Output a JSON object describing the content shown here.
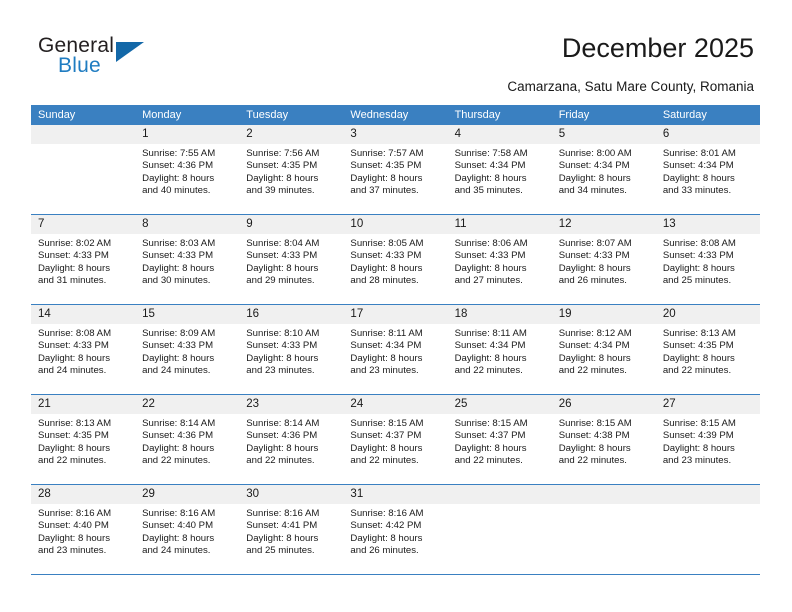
{
  "brand": {
    "name_part1": "General",
    "name_part2": "Blue",
    "accent_color": "#1368a8"
  },
  "header": {
    "title": "December 2025",
    "location": "Camarzana, Satu Mare County, Romania"
  },
  "calendar": {
    "header_bg": "#3a80c1",
    "weekdays": [
      "Sunday",
      "Monday",
      "Tuesday",
      "Wednesday",
      "Thursday",
      "Friday",
      "Saturday"
    ],
    "weeks": [
      [
        {
          "day": "",
          "lines": []
        },
        {
          "day": "1",
          "lines": [
            "Sunrise: 7:55 AM",
            "Sunset: 4:36 PM",
            "Daylight: 8 hours",
            "and 40 minutes."
          ]
        },
        {
          "day": "2",
          "lines": [
            "Sunrise: 7:56 AM",
            "Sunset: 4:35 PM",
            "Daylight: 8 hours",
            "and 39 minutes."
          ]
        },
        {
          "day": "3",
          "lines": [
            "Sunrise: 7:57 AM",
            "Sunset: 4:35 PM",
            "Daylight: 8 hours",
            "and 37 minutes."
          ]
        },
        {
          "day": "4",
          "lines": [
            "Sunrise: 7:58 AM",
            "Sunset: 4:34 PM",
            "Daylight: 8 hours",
            "and 35 minutes."
          ]
        },
        {
          "day": "5",
          "lines": [
            "Sunrise: 8:00 AM",
            "Sunset: 4:34 PM",
            "Daylight: 8 hours",
            "and 34 minutes."
          ]
        },
        {
          "day": "6",
          "lines": [
            "Sunrise: 8:01 AM",
            "Sunset: 4:34 PM",
            "Daylight: 8 hours",
            "and 33 minutes."
          ]
        }
      ],
      [
        {
          "day": "7",
          "lines": [
            "Sunrise: 8:02 AM",
            "Sunset: 4:33 PM",
            "Daylight: 8 hours",
            "and 31 minutes."
          ]
        },
        {
          "day": "8",
          "lines": [
            "Sunrise: 8:03 AM",
            "Sunset: 4:33 PM",
            "Daylight: 8 hours",
            "and 30 minutes."
          ]
        },
        {
          "day": "9",
          "lines": [
            "Sunrise: 8:04 AM",
            "Sunset: 4:33 PM",
            "Daylight: 8 hours",
            "and 29 minutes."
          ]
        },
        {
          "day": "10",
          "lines": [
            "Sunrise: 8:05 AM",
            "Sunset: 4:33 PM",
            "Daylight: 8 hours",
            "and 28 minutes."
          ]
        },
        {
          "day": "11",
          "lines": [
            "Sunrise: 8:06 AM",
            "Sunset: 4:33 PM",
            "Daylight: 8 hours",
            "and 27 minutes."
          ]
        },
        {
          "day": "12",
          "lines": [
            "Sunrise: 8:07 AM",
            "Sunset: 4:33 PM",
            "Daylight: 8 hours",
            "and 26 minutes."
          ]
        },
        {
          "day": "13",
          "lines": [
            "Sunrise: 8:08 AM",
            "Sunset: 4:33 PM",
            "Daylight: 8 hours",
            "and 25 minutes."
          ]
        }
      ],
      [
        {
          "day": "14",
          "lines": [
            "Sunrise: 8:08 AM",
            "Sunset: 4:33 PM",
            "Daylight: 8 hours",
            "and 24 minutes."
          ]
        },
        {
          "day": "15",
          "lines": [
            "Sunrise: 8:09 AM",
            "Sunset: 4:33 PM",
            "Daylight: 8 hours",
            "and 24 minutes."
          ]
        },
        {
          "day": "16",
          "lines": [
            "Sunrise: 8:10 AM",
            "Sunset: 4:33 PM",
            "Daylight: 8 hours",
            "and 23 minutes."
          ]
        },
        {
          "day": "17",
          "lines": [
            "Sunrise: 8:11 AM",
            "Sunset: 4:34 PM",
            "Daylight: 8 hours",
            "and 23 minutes."
          ]
        },
        {
          "day": "18",
          "lines": [
            "Sunrise: 8:11 AM",
            "Sunset: 4:34 PM",
            "Daylight: 8 hours",
            "and 22 minutes."
          ]
        },
        {
          "day": "19",
          "lines": [
            "Sunrise: 8:12 AM",
            "Sunset: 4:34 PM",
            "Daylight: 8 hours",
            "and 22 minutes."
          ]
        },
        {
          "day": "20",
          "lines": [
            "Sunrise: 8:13 AM",
            "Sunset: 4:35 PM",
            "Daylight: 8 hours",
            "and 22 minutes."
          ]
        }
      ],
      [
        {
          "day": "21",
          "lines": [
            "Sunrise: 8:13 AM",
            "Sunset: 4:35 PM",
            "Daylight: 8 hours",
            "and 22 minutes."
          ]
        },
        {
          "day": "22",
          "lines": [
            "Sunrise: 8:14 AM",
            "Sunset: 4:36 PM",
            "Daylight: 8 hours",
            "and 22 minutes."
          ]
        },
        {
          "day": "23",
          "lines": [
            "Sunrise: 8:14 AM",
            "Sunset: 4:36 PM",
            "Daylight: 8 hours",
            "and 22 minutes."
          ]
        },
        {
          "day": "24",
          "lines": [
            "Sunrise: 8:15 AM",
            "Sunset: 4:37 PM",
            "Daylight: 8 hours",
            "and 22 minutes."
          ]
        },
        {
          "day": "25",
          "lines": [
            "Sunrise: 8:15 AM",
            "Sunset: 4:37 PM",
            "Daylight: 8 hours",
            "and 22 minutes."
          ]
        },
        {
          "day": "26",
          "lines": [
            "Sunrise: 8:15 AM",
            "Sunset: 4:38 PM",
            "Daylight: 8 hours",
            "and 22 minutes."
          ]
        },
        {
          "day": "27",
          "lines": [
            "Sunrise: 8:15 AM",
            "Sunset: 4:39 PM",
            "Daylight: 8 hours",
            "and 23 minutes."
          ]
        }
      ],
      [
        {
          "day": "28",
          "lines": [
            "Sunrise: 8:16 AM",
            "Sunset: 4:40 PM",
            "Daylight: 8 hours",
            "and 23 minutes."
          ]
        },
        {
          "day": "29",
          "lines": [
            "Sunrise: 8:16 AM",
            "Sunset: 4:40 PM",
            "Daylight: 8 hours",
            "and 24 minutes."
          ]
        },
        {
          "day": "30",
          "lines": [
            "Sunrise: 8:16 AM",
            "Sunset: 4:41 PM",
            "Daylight: 8 hours",
            "and 25 minutes."
          ]
        },
        {
          "day": "31",
          "lines": [
            "Sunrise: 8:16 AM",
            "Sunset: 4:42 PM",
            "Daylight: 8 hours",
            "and 26 minutes."
          ]
        },
        {
          "day": "",
          "lines": []
        },
        {
          "day": "",
          "lines": []
        },
        {
          "day": "",
          "lines": []
        }
      ]
    ]
  }
}
